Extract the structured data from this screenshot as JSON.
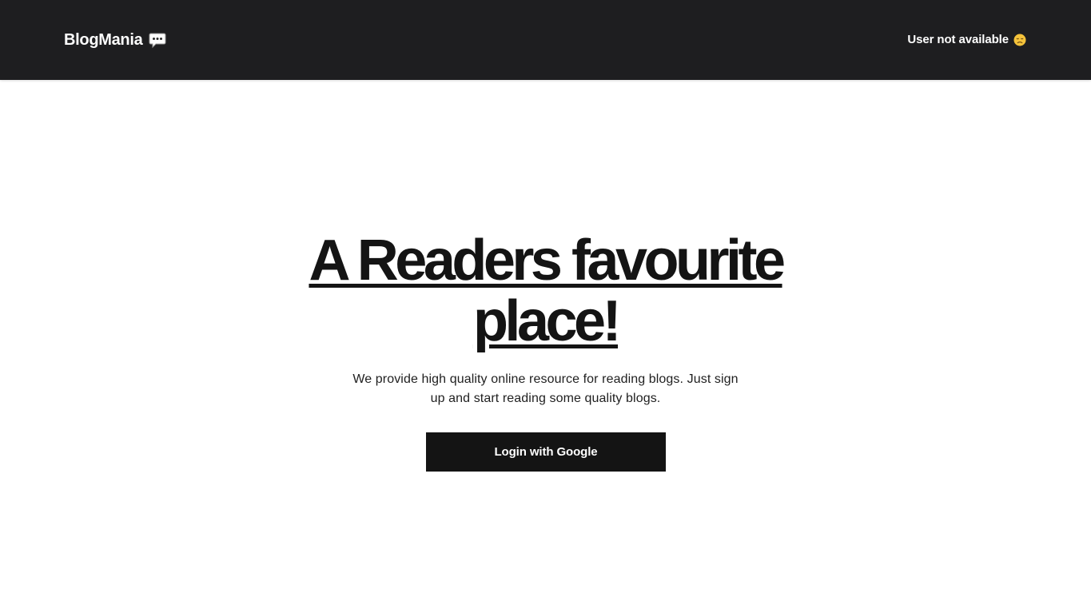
{
  "navbar": {
    "brand": "BlogMania",
    "brand_icon": "speech-bubble-icon",
    "user_status": "User not available",
    "user_status_icon": "disappointed-face-icon"
  },
  "hero": {
    "title": "A Readers favourite place!",
    "subtitle": "We provide high quality online resource for reading blogs. Just sign up and start reading some quality blogs.",
    "login_button": "Login with Google"
  },
  "colors": {
    "navbar_bg": "#1e1e20",
    "text_dark": "#141414",
    "button_bg": "#141414",
    "emoji_yellow": "#f5c33b"
  }
}
